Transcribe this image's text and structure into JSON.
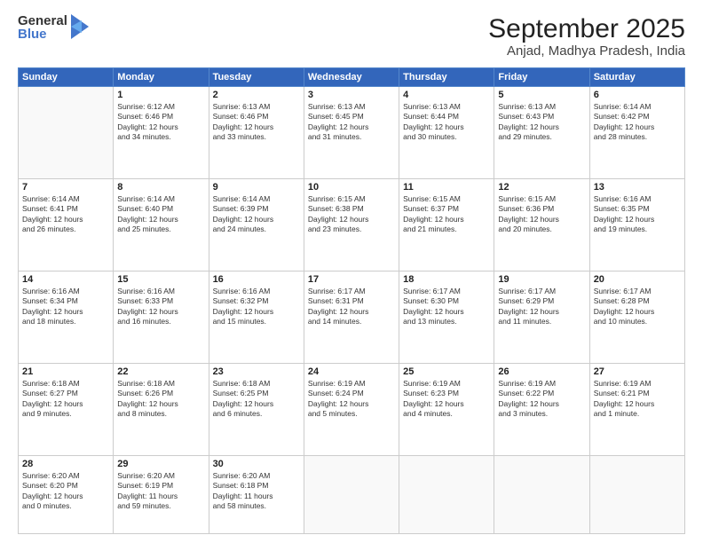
{
  "header": {
    "logo_general": "General",
    "logo_blue": "Blue",
    "month": "September 2025",
    "location": "Anjad, Madhya Pradesh, India"
  },
  "weekdays": [
    "Sunday",
    "Monday",
    "Tuesday",
    "Wednesday",
    "Thursday",
    "Friday",
    "Saturday"
  ],
  "weeks": [
    [
      {
        "day": "",
        "info": ""
      },
      {
        "day": "1",
        "info": "Sunrise: 6:12 AM\nSunset: 6:46 PM\nDaylight: 12 hours\nand 34 minutes."
      },
      {
        "day": "2",
        "info": "Sunrise: 6:13 AM\nSunset: 6:46 PM\nDaylight: 12 hours\nand 33 minutes."
      },
      {
        "day": "3",
        "info": "Sunrise: 6:13 AM\nSunset: 6:45 PM\nDaylight: 12 hours\nand 31 minutes."
      },
      {
        "day": "4",
        "info": "Sunrise: 6:13 AM\nSunset: 6:44 PM\nDaylight: 12 hours\nand 30 minutes."
      },
      {
        "day": "5",
        "info": "Sunrise: 6:13 AM\nSunset: 6:43 PM\nDaylight: 12 hours\nand 29 minutes."
      },
      {
        "day": "6",
        "info": "Sunrise: 6:14 AM\nSunset: 6:42 PM\nDaylight: 12 hours\nand 28 minutes."
      }
    ],
    [
      {
        "day": "7",
        "info": "Sunrise: 6:14 AM\nSunset: 6:41 PM\nDaylight: 12 hours\nand 26 minutes."
      },
      {
        "day": "8",
        "info": "Sunrise: 6:14 AM\nSunset: 6:40 PM\nDaylight: 12 hours\nand 25 minutes."
      },
      {
        "day": "9",
        "info": "Sunrise: 6:14 AM\nSunset: 6:39 PM\nDaylight: 12 hours\nand 24 minutes."
      },
      {
        "day": "10",
        "info": "Sunrise: 6:15 AM\nSunset: 6:38 PM\nDaylight: 12 hours\nand 23 minutes."
      },
      {
        "day": "11",
        "info": "Sunrise: 6:15 AM\nSunset: 6:37 PM\nDaylight: 12 hours\nand 21 minutes."
      },
      {
        "day": "12",
        "info": "Sunrise: 6:15 AM\nSunset: 6:36 PM\nDaylight: 12 hours\nand 20 minutes."
      },
      {
        "day": "13",
        "info": "Sunrise: 6:16 AM\nSunset: 6:35 PM\nDaylight: 12 hours\nand 19 minutes."
      }
    ],
    [
      {
        "day": "14",
        "info": "Sunrise: 6:16 AM\nSunset: 6:34 PM\nDaylight: 12 hours\nand 18 minutes."
      },
      {
        "day": "15",
        "info": "Sunrise: 6:16 AM\nSunset: 6:33 PM\nDaylight: 12 hours\nand 16 minutes."
      },
      {
        "day": "16",
        "info": "Sunrise: 6:16 AM\nSunset: 6:32 PM\nDaylight: 12 hours\nand 15 minutes."
      },
      {
        "day": "17",
        "info": "Sunrise: 6:17 AM\nSunset: 6:31 PM\nDaylight: 12 hours\nand 14 minutes."
      },
      {
        "day": "18",
        "info": "Sunrise: 6:17 AM\nSunset: 6:30 PM\nDaylight: 12 hours\nand 13 minutes."
      },
      {
        "day": "19",
        "info": "Sunrise: 6:17 AM\nSunset: 6:29 PM\nDaylight: 12 hours\nand 11 minutes."
      },
      {
        "day": "20",
        "info": "Sunrise: 6:17 AM\nSunset: 6:28 PM\nDaylight: 12 hours\nand 10 minutes."
      }
    ],
    [
      {
        "day": "21",
        "info": "Sunrise: 6:18 AM\nSunset: 6:27 PM\nDaylight: 12 hours\nand 9 minutes."
      },
      {
        "day": "22",
        "info": "Sunrise: 6:18 AM\nSunset: 6:26 PM\nDaylight: 12 hours\nand 8 minutes."
      },
      {
        "day": "23",
        "info": "Sunrise: 6:18 AM\nSunset: 6:25 PM\nDaylight: 12 hours\nand 6 minutes."
      },
      {
        "day": "24",
        "info": "Sunrise: 6:19 AM\nSunset: 6:24 PM\nDaylight: 12 hours\nand 5 minutes."
      },
      {
        "day": "25",
        "info": "Sunrise: 6:19 AM\nSunset: 6:23 PM\nDaylight: 12 hours\nand 4 minutes."
      },
      {
        "day": "26",
        "info": "Sunrise: 6:19 AM\nSunset: 6:22 PM\nDaylight: 12 hours\nand 3 minutes."
      },
      {
        "day": "27",
        "info": "Sunrise: 6:19 AM\nSunset: 6:21 PM\nDaylight: 12 hours\nand 1 minute."
      }
    ],
    [
      {
        "day": "28",
        "info": "Sunrise: 6:20 AM\nSunset: 6:20 PM\nDaylight: 12 hours\nand 0 minutes."
      },
      {
        "day": "29",
        "info": "Sunrise: 6:20 AM\nSunset: 6:19 PM\nDaylight: 11 hours\nand 59 minutes."
      },
      {
        "day": "30",
        "info": "Sunrise: 6:20 AM\nSunset: 6:18 PM\nDaylight: 11 hours\nand 58 minutes."
      },
      {
        "day": "",
        "info": ""
      },
      {
        "day": "",
        "info": ""
      },
      {
        "day": "",
        "info": ""
      },
      {
        "day": "",
        "info": ""
      }
    ]
  ]
}
